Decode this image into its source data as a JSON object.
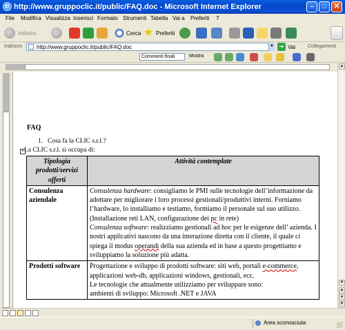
{
  "window": {
    "title": "http://www.gruppoclic.it/public/FAQ.doc - Microsoft Internet Explorer",
    "minimize": "–",
    "maximize": "□",
    "close": "✕"
  },
  "menu": [
    "File",
    "Modifica",
    "Visualizza",
    "Inserisci",
    "Formato",
    "Strumenti",
    "Tabella",
    "Vai a",
    "Preferiti",
    "?"
  ],
  "toolbar": {
    "back_label": "Indietro",
    "search_label": "Cerca",
    "favorites_label": "Preferiti"
  },
  "address": {
    "label": "Indirizzo",
    "url": "http://www.gruppoclic.it/public/FAQ.doc",
    "go_label": "Vai",
    "links_label": "Collegamenti"
  },
  "reviewing": {
    "display_mode": "Commenti finali",
    "show_label": "Mostra"
  },
  "document": {
    "heading": "FAQ",
    "list_number": "1.",
    "question": "Cosa fa la CLIC s.r.l.?",
    "intro": "La CLIC s.r.l. si occupa di:",
    "table": {
      "headers": [
        "Tipologia prodotti/servizi offerti",
        "Attività contemplate"
      ],
      "rows": [
        {
          "category": "Consulenza aziendale",
          "p1_label": "Consulenza hardware",
          "p1_text_a": ": consigliamo le PMI sulle tecnologie dell’informazione da adottare per  migliorare i loro processi gestionali/produttivi interni. Forniamo l’hardware, lo installiamo e testiamo, formiamo il personale sul suo utilizzo.(Installazione reti LAN, configurazione dei ",
          "p1_pc": "pc",
          "p1_text_b": " in rete)",
          "p2_label": "Consulenza software",
          "p2_text_a": ": realizziamo gestionali ad hoc per le esigenze dell’ azienda. I nostri applicativi nascono da una interazione diretta con il cliente, il quale ci spiega il modus ",
          "p2_operandi": "operandi",
          "p2_text_b": " della sua azienda ed in base a questo progettiamo e sviluppiamo la soluzione più adatta."
        },
        {
          "category": "Prodotti software",
          "p1_text_a": "Progettazione e sviluppo di prodotti software: siti web, portali ",
          "p1_ecom": "e-commerce",
          "p1_text_b": ", applicazioni web-db, applicazioni windows, gestionali, ecc.",
          "p2": "Le tecnologie che attualmente utilizziamo per sviluppare sono:",
          "p3": "ambienti di sviluppo: Microsoft .NET e JAVA"
        }
      ]
    }
  },
  "status": {
    "zone": "Area sconosciuta"
  },
  "colors": {
    "titlebar": "#0a4fd6",
    "chrome": "#ece9d8",
    "table_header": "#d4d4d4"
  }
}
